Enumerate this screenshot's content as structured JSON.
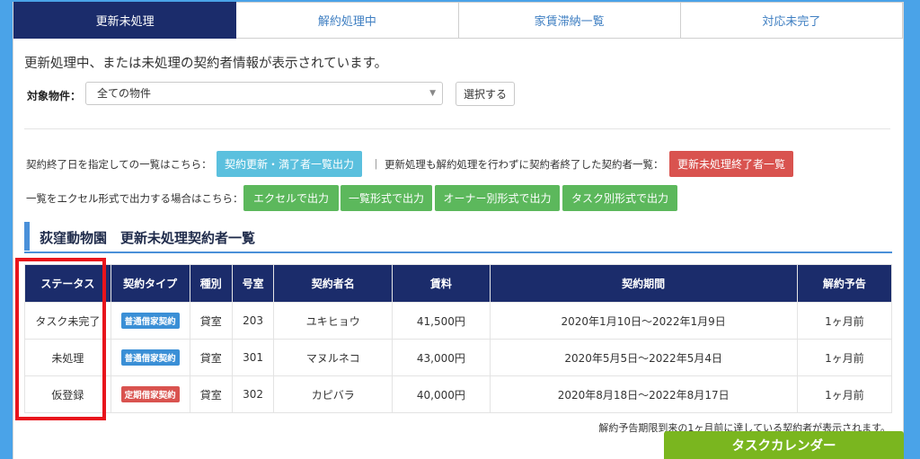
{
  "tabs": [
    {
      "label": "更新未処理",
      "active": true
    },
    {
      "label": "解約処理中",
      "active": false
    },
    {
      "label": "家賃滞納一覧",
      "active": false
    },
    {
      "label": "対応未完了",
      "active": false
    }
  ],
  "description": "更新処理中、または未処理の契約者情報が表示されています。",
  "filter": {
    "label": "対象物件：",
    "selected": "全ての物件",
    "button": "選択する"
  },
  "export_row1": {
    "text1": "契約終了日を指定しての一覧はこちら：",
    "button1": "契約更新・満了者一覧出力",
    "separator": "｜",
    "text2": "更新処理も解約処理を行わずに契約者終了した契約者一覧：",
    "button2": "更新未処理終了者一覧"
  },
  "export_row2": {
    "text": "一覧をエクセル形式で出力する場合はこちら：",
    "buttons": [
      "エクセルで出力",
      "一覧形式で出力",
      "オーナー別形式で出力",
      "タスク別形式で出力"
    ]
  },
  "section_title": "荻窪動物園　更新未処理契約者一覧",
  "table": {
    "headers": [
      "ステータス",
      "契約タイプ",
      "種別",
      "号室",
      "契約者名",
      "賃料",
      "契約期間",
      "解約予告"
    ],
    "rows": [
      {
        "status": "タスク未完了",
        "type": "普通借家契約",
        "type_color": "blue",
        "kind": "貸室",
        "room": "203",
        "name": "ユキヒョウ",
        "rent": "41,500円",
        "period": "2020年1月10日～2022年1月9日",
        "notice": "1ヶ月前"
      },
      {
        "status": "未処理",
        "type": "普通借家契約",
        "type_color": "blue",
        "kind": "貸室",
        "room": "301",
        "name": "マヌルネコ",
        "rent": "43,000円",
        "period": "2020年5月5日～2022年5月4日",
        "notice": "1ヶ月前"
      },
      {
        "status": "仮登録",
        "type": "定期借家契約",
        "type_color": "red",
        "kind": "貸室",
        "room": "302",
        "name": "カピバラ",
        "rent": "40,000円",
        "period": "2020年8月18日～2022年8月17日",
        "notice": "1ヶ月前"
      }
    ]
  },
  "note": "解約予告期限到来の1ヶ月前に達している契約者が表示されます。",
  "calendar_button": "タスクカレンダー"
}
